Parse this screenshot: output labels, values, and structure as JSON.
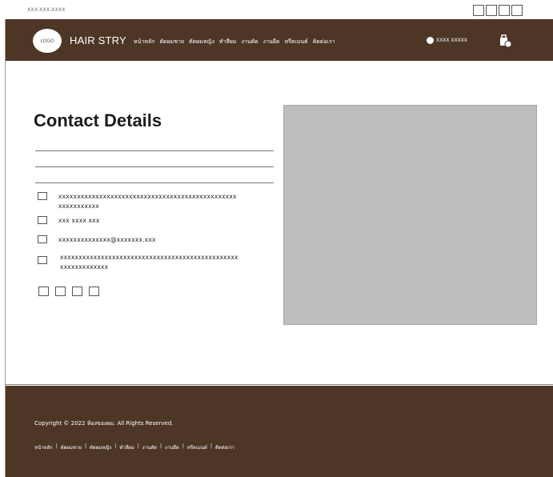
{
  "topbar": {
    "phone": "XXX-XXX-XXXX"
  },
  "nav": {
    "logo_text": "LOGO",
    "brand": "HAIR STRY",
    "menu": [
      "หน้าหลัก",
      "ตัดผมชาย",
      "ตัดผมหญิง",
      "ทำสีผม",
      "งานตัด",
      "งานยืด",
      "ทรีตเมนต์",
      "ติดต่อเรา"
    ],
    "user_name": "XXXX XXXXX"
  },
  "main": {
    "title": "Contact Details",
    "rows": [
      {
        "icon": "location-icon",
        "text": "xxxxxxxxxxxxxxxxxxxxxxxxxxxxxxxxxxxxxxxxxxxxxxxxxxxxxxxxxxx"
      },
      {
        "icon": "phone-icon",
        "text": "xxx xxxx xxx"
      },
      {
        "icon": "email-icon",
        "text": "xxxxxxxxxxxxxx@xxxxxxx.xxx"
      },
      {
        "icon": "clock-icon",
        "text": "xxxxxxxxxxxxxxxxxxxxxxxxxxxxxxxxxxxxxxxxxxxxxxxxxxxxxxxxxxxxx"
      }
    ]
  },
  "footer": {
    "copyright": "Copyright © 2022 ห้องของผม. All Rights Reserved.",
    "links": [
      "หน้าหลัก",
      "ตัดผมชาย",
      "ตัดผมหญิง",
      "ทำสีผม",
      "งานตัด",
      "งานยืด",
      "ทรีตเมนต์",
      "ติดต่อเรา"
    ],
    "separator": "|"
  },
  "colors": {
    "brand_brown": "#4e3627",
    "map_gray": "#bdbec0"
  }
}
